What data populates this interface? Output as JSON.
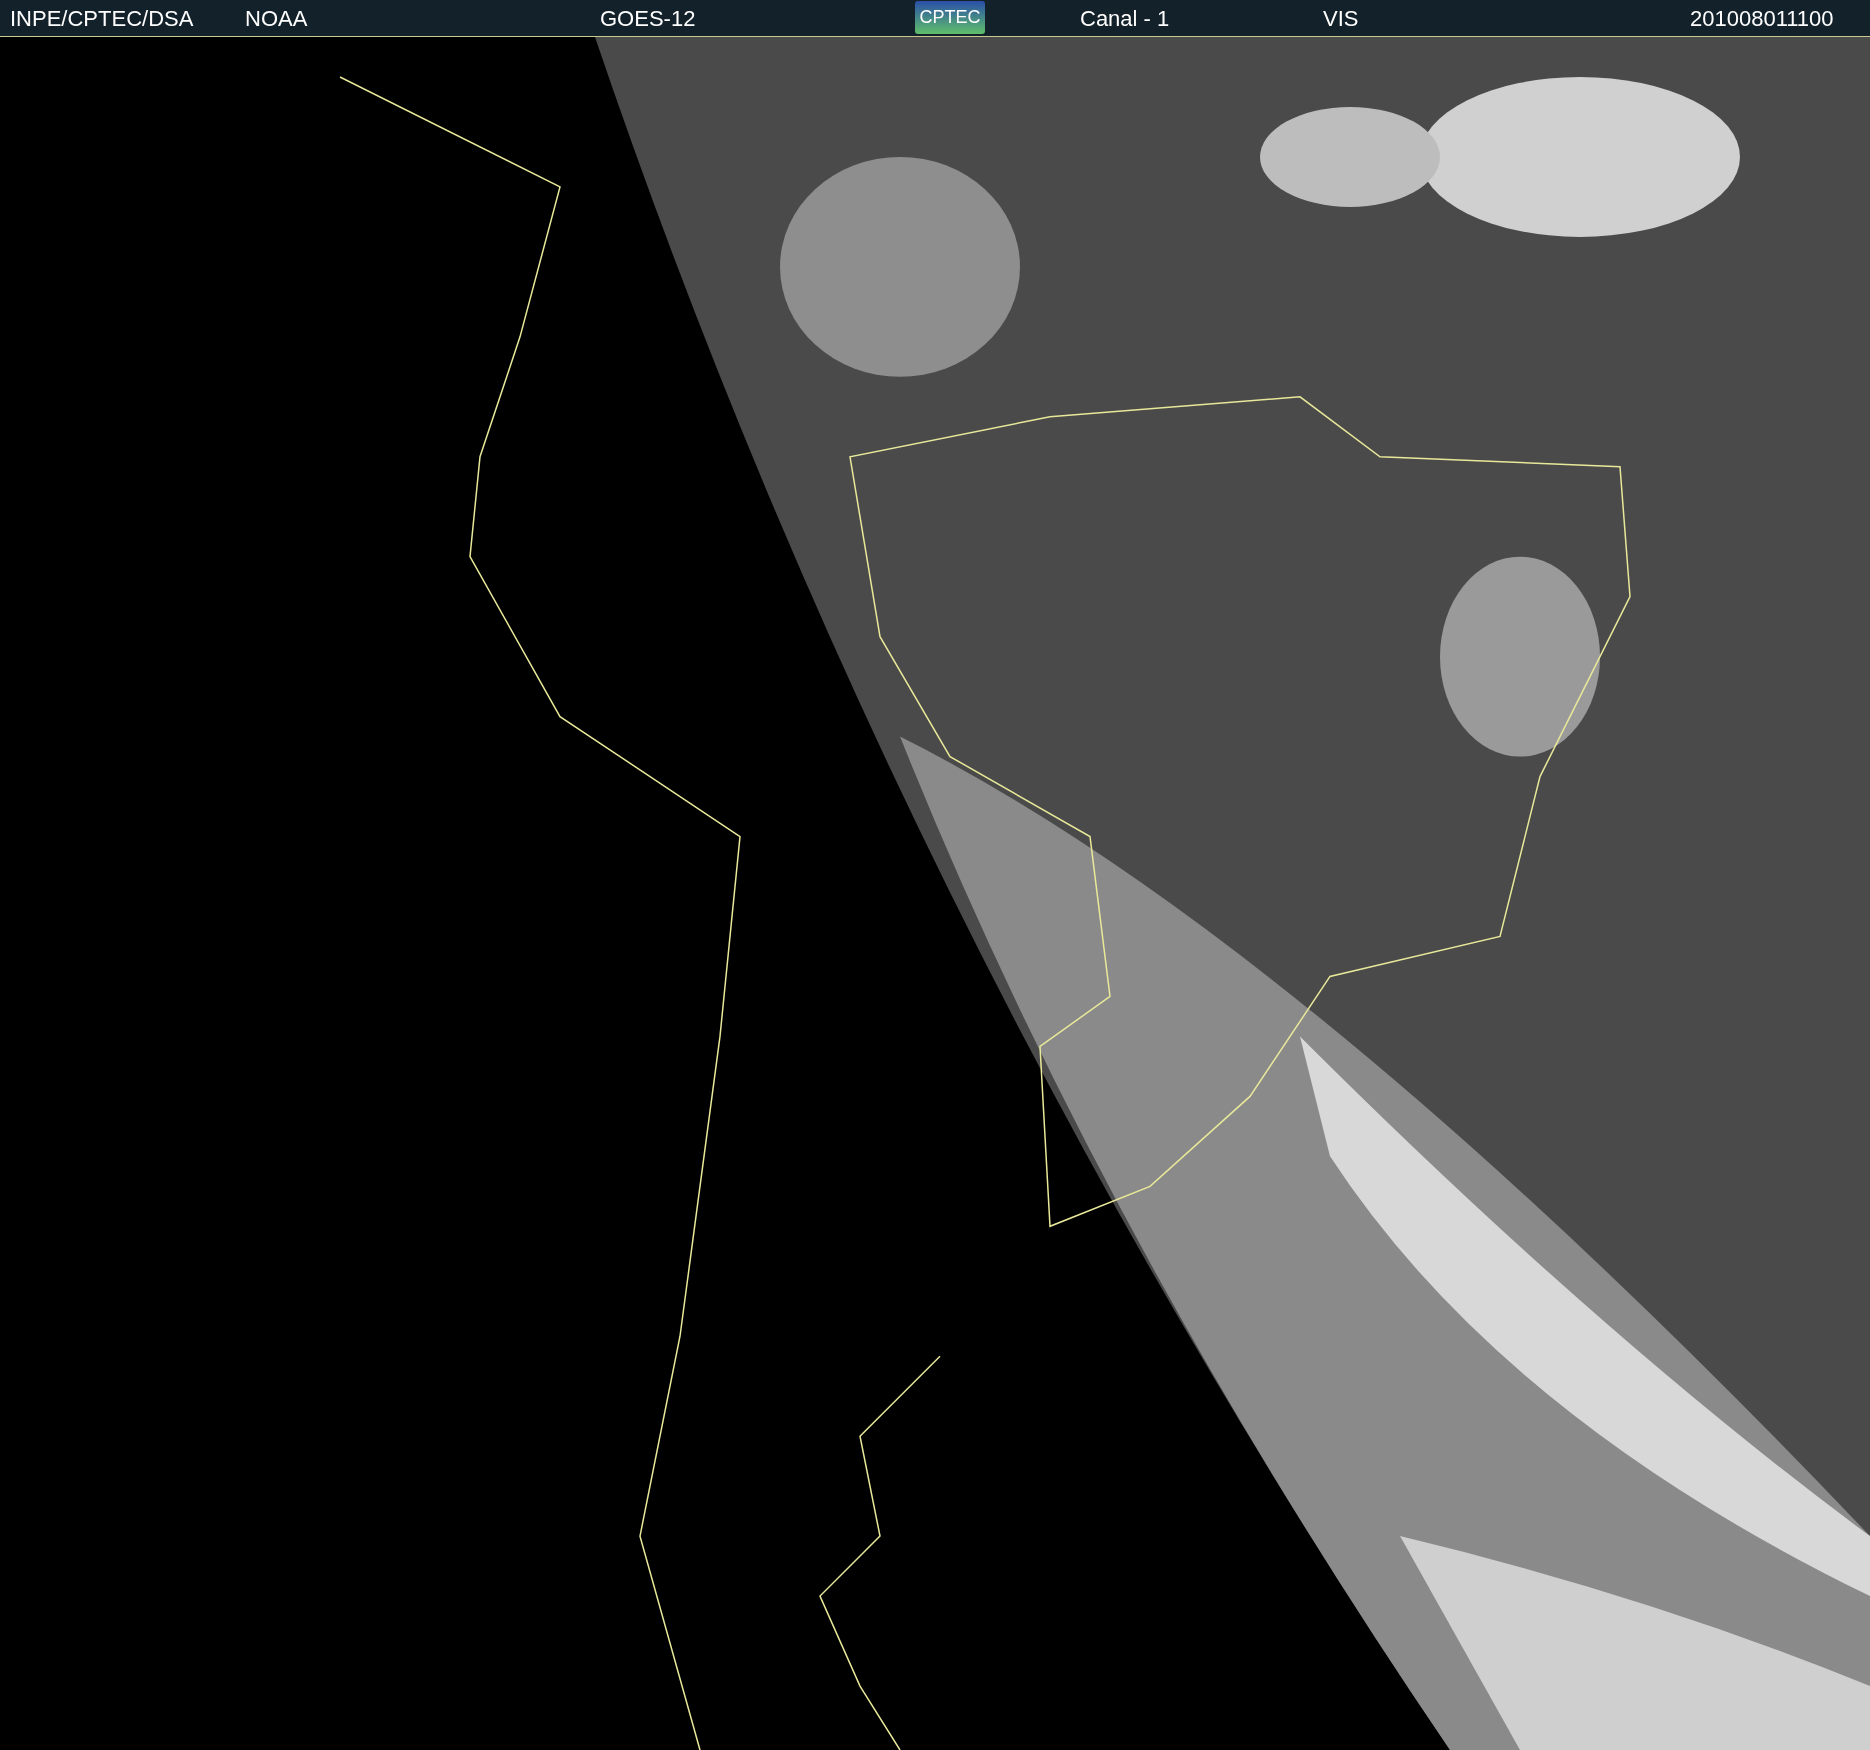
{
  "header": {
    "source": "INPE/CPTEC/DSA",
    "agency": "NOAA",
    "satellite": "GOES-12",
    "logo": "CPTEC",
    "channel": "Canal - 1",
    "band": "VIS",
    "timestamp": "201008011100"
  }
}
